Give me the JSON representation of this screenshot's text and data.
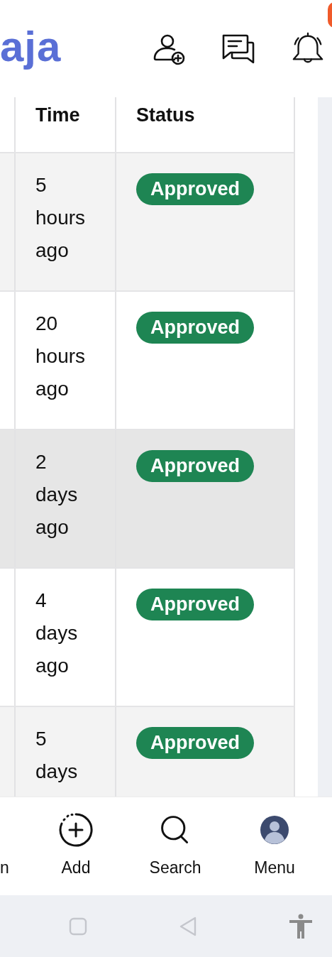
{
  "header": {
    "logo": "aja"
  },
  "table": {
    "columns": [
      "Time",
      "Status"
    ],
    "rows": [
      {
        "time": "5 hours ago",
        "status": "Approved",
        "kind": "approved",
        "hovered": false
      },
      {
        "time": "20 hours ago",
        "status": "Approved",
        "kind": "approved",
        "hovered": false
      },
      {
        "time": "2 days ago",
        "status": "Approved",
        "kind": "approved",
        "hovered": true
      },
      {
        "time": "4 days ago",
        "status": "Approved",
        "kind": "approved",
        "hovered": false
      },
      {
        "time": "5 days",
        "status": "Approved",
        "kind": "approved",
        "hovered": false
      }
    ]
  },
  "bottom_nav": [
    {
      "label": "n",
      "kind": "cut"
    },
    {
      "label": "Add",
      "kind": "add"
    },
    {
      "label": "Search",
      "kind": "search"
    },
    {
      "label": "Menu",
      "kind": "avatar"
    }
  ]
}
